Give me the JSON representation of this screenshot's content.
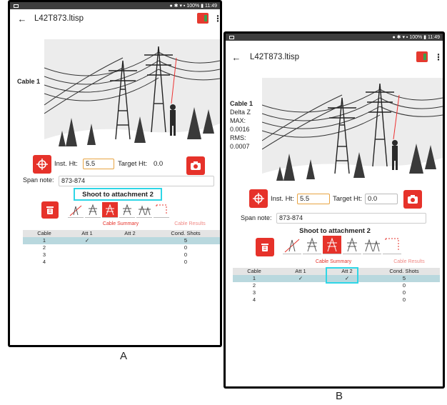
{
  "status_bar": {
    "battery": "100%",
    "time": "11:49"
  },
  "app_bar": {
    "back": "←",
    "title": "L42T873.ltisp",
    "menu": "⋮"
  },
  "panel_a": {
    "caption": "A",
    "cable_label": "Cable 1",
    "inst_label": "Inst. Ht:",
    "inst_value": "5.5",
    "target_label": "Target Ht:",
    "target_value": "0.0",
    "span_label": "Span note:",
    "span_value": "873-874",
    "shoot_text": "Shoot to attachment 2",
    "tabs": [
      "Cable Summary",
      "Cable Results"
    ],
    "table": {
      "headers": [
        "Cable",
        "Att 1",
        "Att 2",
        "Cond. Shots"
      ],
      "rows": [
        [
          "1",
          "✓",
          "",
          "5"
        ],
        [
          "2",
          "",
          "",
          "0"
        ],
        [
          "3",
          "",
          "",
          "0"
        ],
        [
          "4",
          "",
          "",
          "0"
        ]
      ]
    }
  },
  "panel_b": {
    "caption": "B",
    "cable_label": "Cable 1",
    "delta_label": "Delta Z",
    "max_label": "MAX:",
    "max_value": "0.0016",
    "rms_label": "RMS:",
    "rms_value": "0.0007",
    "inst_label": "Inst. Ht:",
    "inst_value": "5.5",
    "target_label": "Target Ht:",
    "target_value": "0.0",
    "span_label": "Span note:",
    "span_value": "873-874",
    "shoot_text": "Shoot to attachment 2",
    "tabs": [
      "Cable Summary",
      "Cable Results"
    ],
    "table": {
      "headers": [
        "Cable",
        "Att 1",
        "Att 2",
        "Cond. Shots"
      ],
      "rows": [
        [
          "1",
          "✓",
          "✓",
          "5"
        ],
        [
          "2",
          "",
          "",
          "0"
        ],
        [
          "3",
          "",
          "",
          "0"
        ],
        [
          "4",
          "",
          "",
          "0"
        ]
      ]
    }
  },
  "colors": {
    "accent_red": "#e6322a",
    "highlight_cyan": "#2fd6e6",
    "selected_row": "#b9d8de"
  },
  "icons": [
    "back-arrow-icon",
    "app-logo-icon",
    "kebab-menu-icon",
    "crosshair-icon",
    "camera-icon",
    "trash-icon"
  ]
}
